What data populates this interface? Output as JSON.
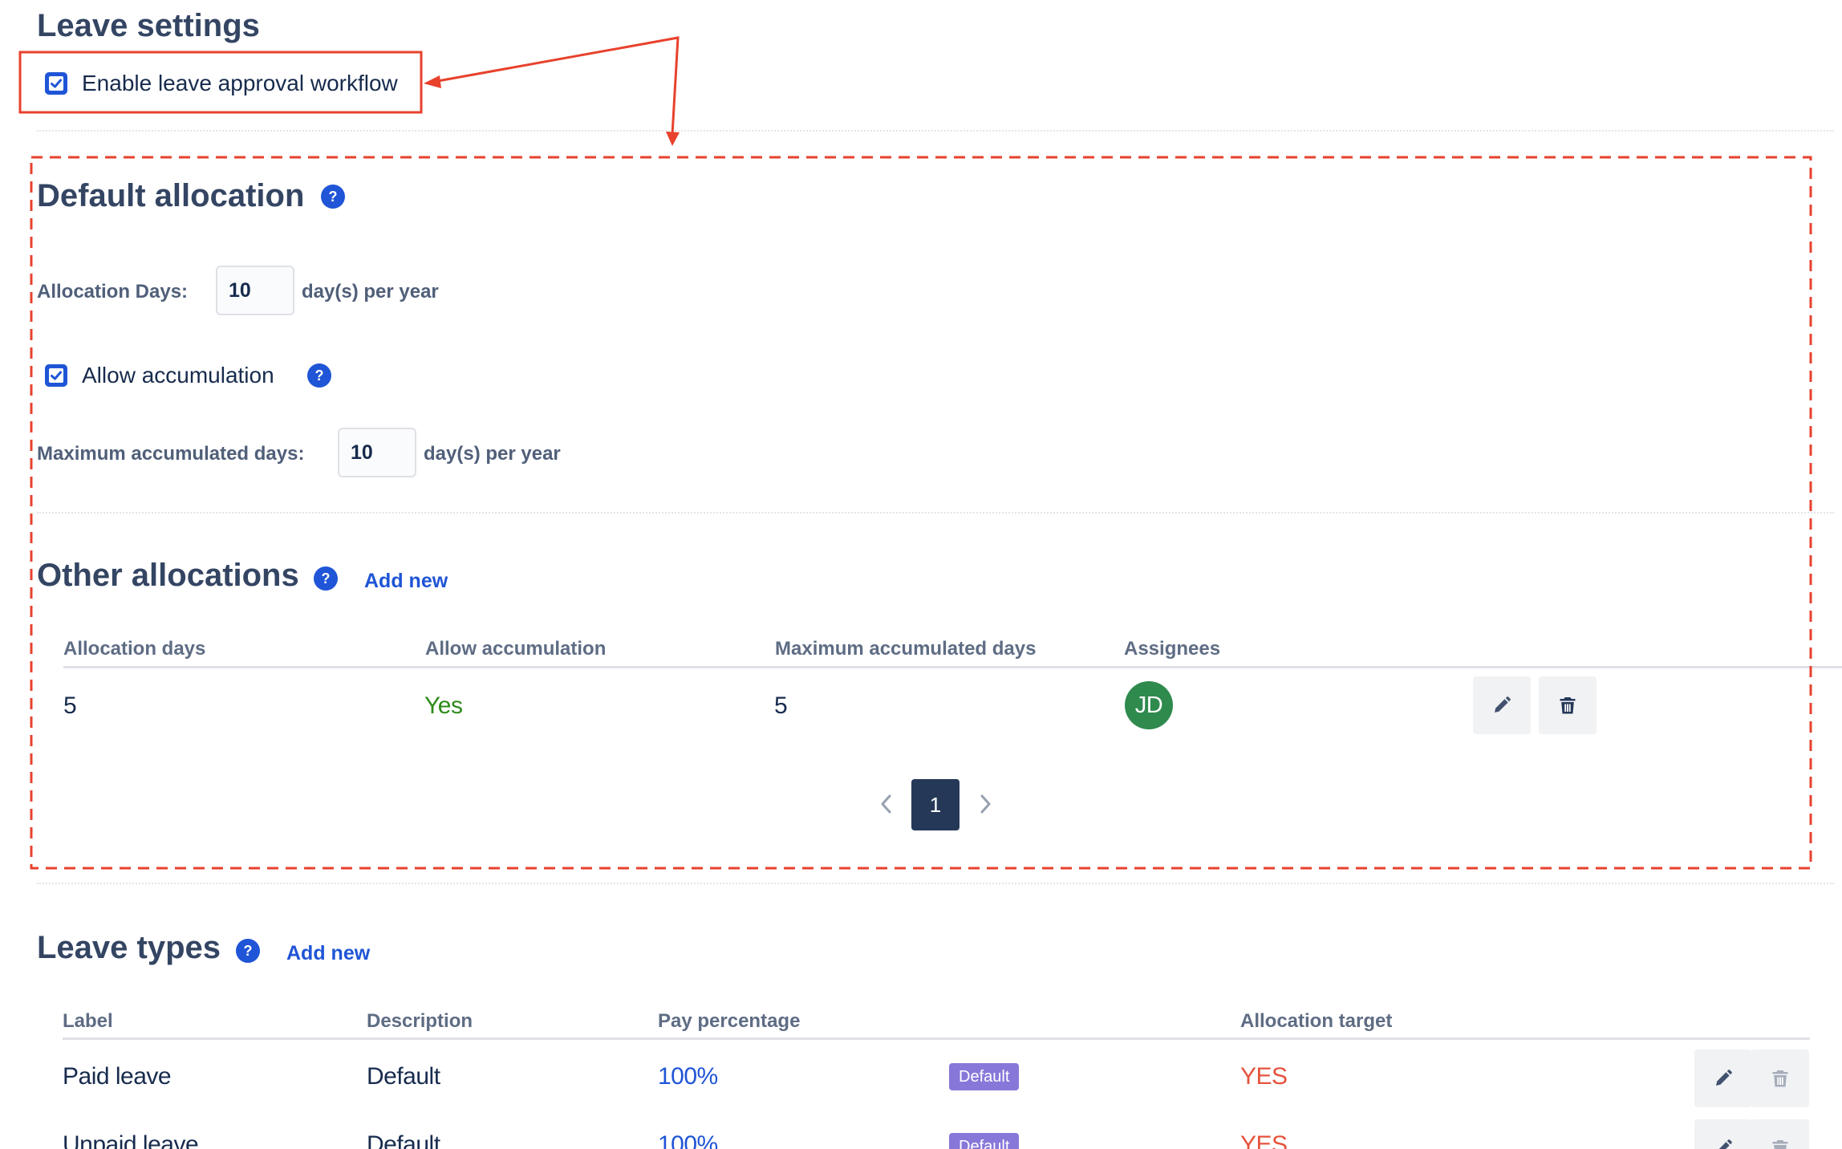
{
  "leave_settings": {
    "title": "Leave settings",
    "enable_workflow": {
      "label": "Enable leave approval workflow",
      "checked": true
    }
  },
  "default_allocation": {
    "title": "Default allocation",
    "allocation_days_label": "Allocation Days:",
    "allocation_days_value": "10",
    "allocation_days_suffix": "day(s) per year",
    "allow_accumulation": {
      "label": "Allow accumulation",
      "checked": true
    },
    "max_accumulated_label": "Maximum accumulated days:",
    "max_accumulated_value": "10",
    "max_accumulated_suffix": "day(s) per year"
  },
  "other_allocations": {
    "title": "Other allocations",
    "add_new": "Add new",
    "columns": [
      "Allocation days",
      "Allow accumulation",
      "Maximum accumulated days",
      "Assignees"
    ],
    "rows": [
      {
        "allocation_days": "5",
        "allow_accumulation": "Yes",
        "max_accumulated": "5",
        "assignee_initials": "JD"
      }
    ],
    "pagination": {
      "current_page": "1"
    }
  },
  "leave_types": {
    "title": "Leave types",
    "add_new": "Add new",
    "columns": [
      "Label",
      "Description",
      "Pay percentage",
      "Allocation target"
    ],
    "rows": [
      {
        "label": "Paid leave",
        "description": "Default",
        "pay_percentage": "100%",
        "badge": "Default",
        "allocation_target": "YES"
      },
      {
        "label": "Unpaid leave",
        "description": "Default",
        "pay_percentage": "100%",
        "badge": "Default",
        "allocation_target": "YES"
      }
    ]
  },
  "help_glyph": "?",
  "colors": {
    "primary": "#1f55d6",
    "heading": "#344563",
    "success_text": "#2e8b1c",
    "danger_text": "#e5533d",
    "annotation_red": "#e8412c",
    "badge_purple": "#8777d9",
    "avatar_green": "#2f8a4e",
    "pagination_active": "#253858"
  }
}
